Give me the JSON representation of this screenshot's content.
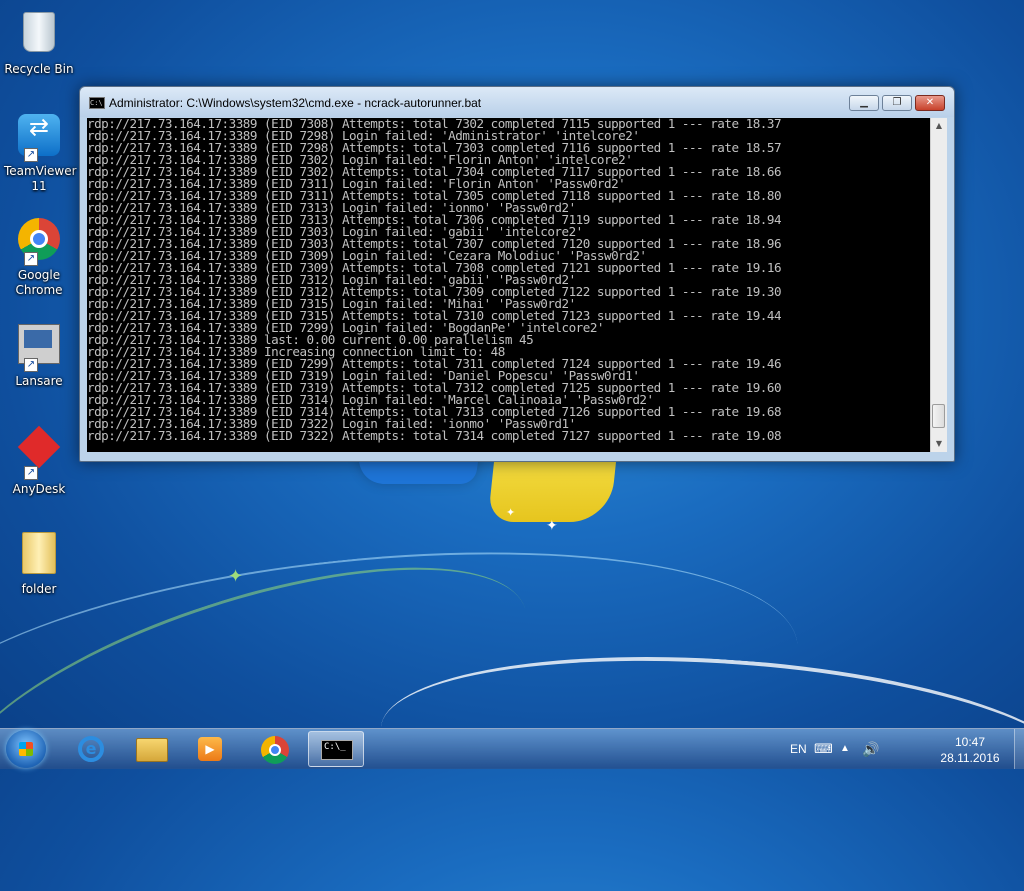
{
  "desktop": {
    "icons": [
      {
        "label": "Recycle Bin",
        "icon": "recycle-bin-icon"
      },
      {
        "label": "TeamViewer 11",
        "icon": "teamviewer-icon"
      },
      {
        "label": "Google Chrome",
        "icon": "chrome-icon"
      },
      {
        "label": "Lansare",
        "icon": "lansare-icon"
      },
      {
        "label": "AnyDesk",
        "icon": "anydesk-icon"
      },
      {
        "label": "folder",
        "icon": "folder-icon"
      }
    ]
  },
  "cmd": {
    "title": "Administrator: C:\\Windows\\system32\\cmd.exe - ncrack-autorunner.bat",
    "icon": "cmd-icon",
    "controls": {
      "minimize": "minimize-icon",
      "maximize": "maximize-icon",
      "close": "close-icon"
    },
    "lines": [
      "rdp://217.73.164.17:3389 (EID 7308) Attempts: total 7302 completed 7115 supported 1 --- rate 18.37",
      "rdp://217.73.164.17:3389 (EID 7298) Login failed: 'Administrator' 'intelcore2'",
      "rdp://217.73.164.17:3389 (EID 7298) Attempts: total 7303 completed 7116 supported 1 --- rate 18.57",
      "rdp://217.73.164.17:3389 (EID 7302) Login failed: 'Florin Anton' 'intelcore2'",
      "rdp://217.73.164.17:3389 (EID 7302) Attempts: total 7304 completed 7117 supported 1 --- rate 18.66",
      "rdp://217.73.164.17:3389 (EID 7311) Login failed: 'Florin Anton' 'Passw0rd2'",
      "rdp://217.73.164.17:3389 (EID 7311) Attempts: total 7305 completed 7118 supported 1 --- rate 18.80",
      "rdp://217.73.164.17:3389 (EID 7313) Login failed: 'ionmo' 'Passw0rd2'",
      "rdp://217.73.164.17:3389 (EID 7313) Attempts: total 7306 completed 7119 supported 1 --- rate 18.94",
      "rdp://217.73.164.17:3389 (EID 7303) Login failed: 'gabii' 'intelcore2'",
      "rdp://217.73.164.17:3389 (EID 7303) Attempts: total 7307 completed 7120 supported 1 --- rate 18.96",
      "rdp://217.73.164.17:3389 (EID 7309) Login failed: 'Cezara Molodiuc' 'Passw0rd2'",
      "rdp://217.73.164.17:3389 (EID 7309) Attempts: total 7308 completed 7121 supported 1 --- rate 19.16",
      "rdp://217.73.164.17:3389 (EID 7312) Login failed: 'gabii' 'Passw0rd2'",
      "rdp://217.73.164.17:3389 (EID 7312) Attempts: total 7309 completed 7122 supported 1 --- rate 19.30",
      "rdp://217.73.164.17:3389 (EID 7315) Login failed: 'Mihai' 'Passw0rd2'",
      "rdp://217.73.164.17:3389 (EID 7315) Attempts: total 7310 completed 7123 supported 1 --- rate 19.44",
      "rdp://217.73.164.17:3389 (EID 7299) Login failed: 'BogdanPe' 'intelcore2'",
      "rdp://217.73.164.17:3389 last: 0.00 current 0.00 parallelism 45",
      "rdp://217.73.164.17:3389 Increasing connection limit to: 48",
      "rdp://217.73.164.17:3389 (EID 7299) Attempts: total 7311 completed 7124 supported 1 --- rate 19.46",
      "rdp://217.73.164.17:3389 (EID 7319) Login failed: 'Daniel Popescu' 'Passw0rd1'",
      "rdp://217.73.164.17:3389 (EID 7319) Attempts: total 7312 completed 7125 supported 1 --- rate 19.60",
      "rdp://217.73.164.17:3389 (EID 7314) Login failed: 'Marcel Calinoaia' 'Passw0rd2'",
      "rdp://217.73.164.17:3389 (EID 7314) Attempts: total 7313 completed 7126 supported 1 --- rate 19.68",
      "rdp://217.73.164.17:3389 (EID 7322) Login failed: 'ionmo' 'Passw0rd1'",
      "rdp://217.73.164.17:3389 (EID 7322) Attempts: total 7314 completed 7127 supported 1 --- rate 19.08"
    ],
    "scroll_position": 0.97
  },
  "taskbar": {
    "start_icon": "windows-start-icon",
    "pinned": [
      {
        "name": "internet-explorer",
        "icon": "internet-explorer-icon"
      },
      {
        "name": "windows-explorer",
        "icon": "folder-explorer-icon"
      },
      {
        "name": "media-player",
        "icon": "media-player-icon"
      },
      {
        "name": "google-chrome",
        "icon": "chrome-icon"
      },
      {
        "name": "command-prompt",
        "icon": "cmd-icon",
        "active": true,
        "glyph": "C:\\_"
      }
    ],
    "tray": {
      "language": "EN",
      "icons": [
        "keyboard-icon",
        "show-hidden-icons-icon",
        "volume-icon"
      ],
      "time": "10:47",
      "date": "28.11.2016"
    }
  }
}
